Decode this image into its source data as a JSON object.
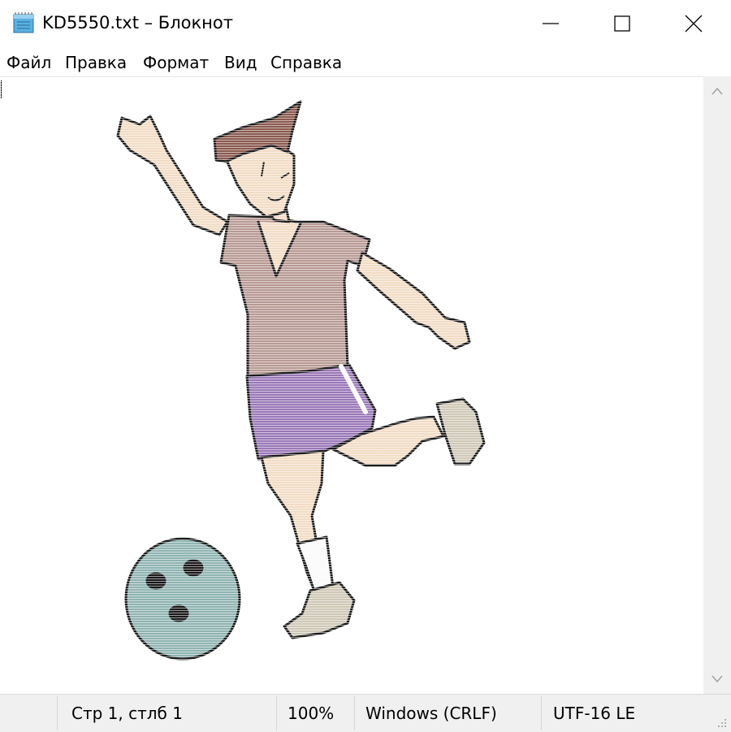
{
  "window": {
    "title": "KD5550.txt – Блокнот",
    "icon": "notepad-icon"
  },
  "controls": {
    "minimize_icon": "minimize-icon",
    "maximize_icon": "maximize-icon",
    "close_icon": "close-icon"
  },
  "menu": {
    "items": [
      {
        "label": "Файл"
      },
      {
        "label": "Правка"
      },
      {
        "label": "Формат"
      },
      {
        "label": "Вид"
      },
      {
        "label": "Справка"
      }
    ]
  },
  "editor": {
    "content_description_icon": "ascii-art-bowler",
    "colors": {
      "skin": "#f1dcc4",
      "shirt": "#b89a94",
      "shorts": "#9a78b8",
      "ball": "#8fb4b2",
      "hair": "#8a5a4e",
      "shoe": "#cfc8b6"
    }
  },
  "status": {
    "position": "Стр 1, стлб 1",
    "zoom": "100%",
    "line_endings": "Windows (CRLF)",
    "encoding": "UTF-16 LE"
  }
}
